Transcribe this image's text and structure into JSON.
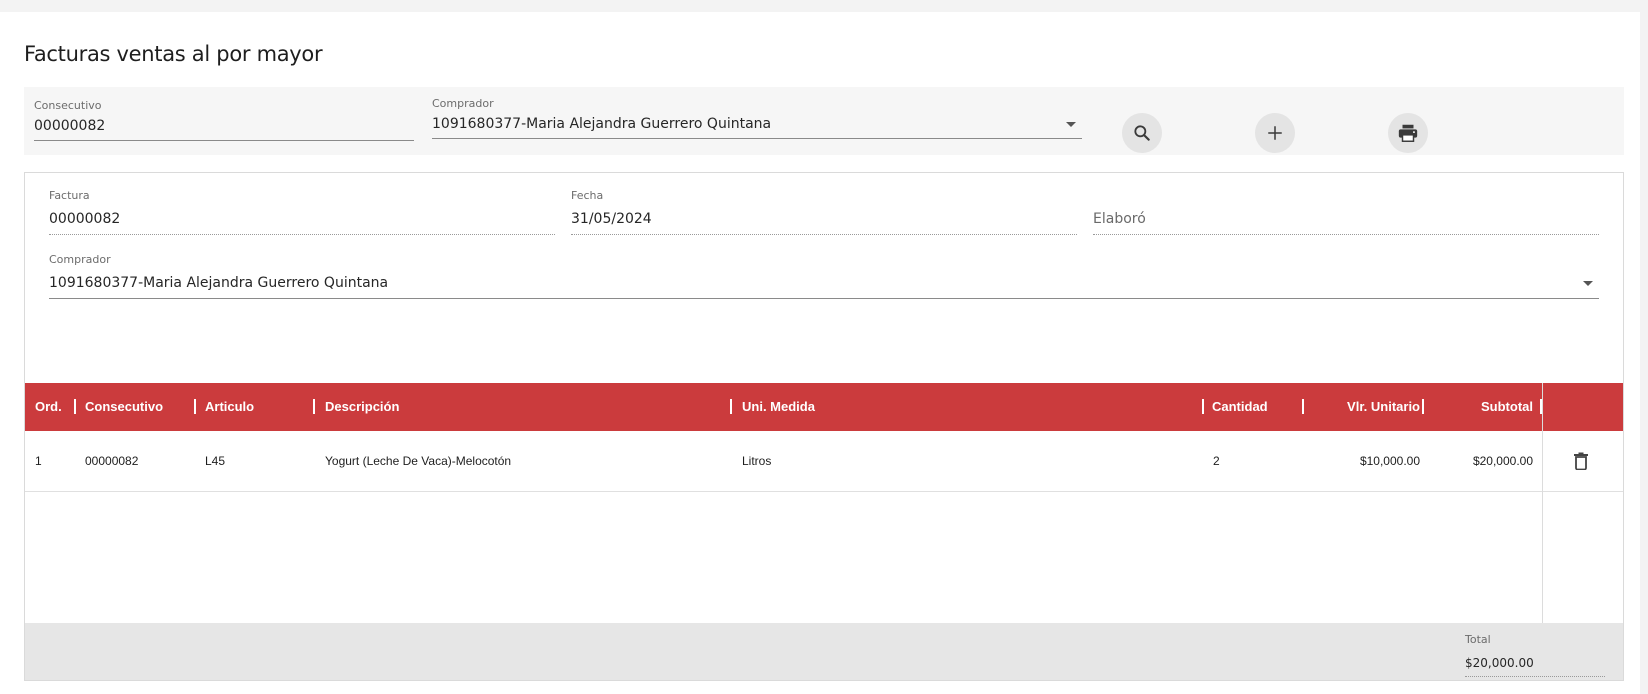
{
  "page": {
    "title": "Facturas ventas al por mayor"
  },
  "search": {
    "consecutivo_label": "Consecutivo",
    "consecutivo_value": "00000082",
    "comprador_label": "Comprador",
    "comprador_value": "1091680377-Maria Alejandra Guerrero Quintana"
  },
  "actions": {
    "search_icon": "search-icon",
    "add_icon": "plus-icon",
    "print_icon": "print-icon"
  },
  "invoice": {
    "factura_label": "Factura",
    "factura_value": "00000082",
    "fecha_label": "Fecha",
    "fecha_value": "31/05/2024",
    "elaboro_placeholder": "Elaboró",
    "comprador_label": "Comprador",
    "comprador_value": "1091680377-Maria Alejandra Guerrero Quintana"
  },
  "table": {
    "headers": [
      "Ord.",
      "Consecutivo",
      "Articulo",
      "Descripción",
      "Uni. Medida",
      "Cantidad",
      "Vlr. Unitario",
      "Subtotal"
    ],
    "rows": [
      [
        "1",
        "00000082",
        "L45",
        "Yogurt (Leche De Vaca)-Melocotón",
        "Litros",
        "2",
        "$10,000.00",
        "$20,000.00"
      ]
    ],
    "delete_icon": "trash-icon"
  },
  "totals": {
    "label": "Total",
    "value": "$20,000.00"
  },
  "colors": {
    "header_bg": "#cb3b3d",
    "header_text": "#ffffff",
    "footer_bg": "#e6e6e6"
  }
}
